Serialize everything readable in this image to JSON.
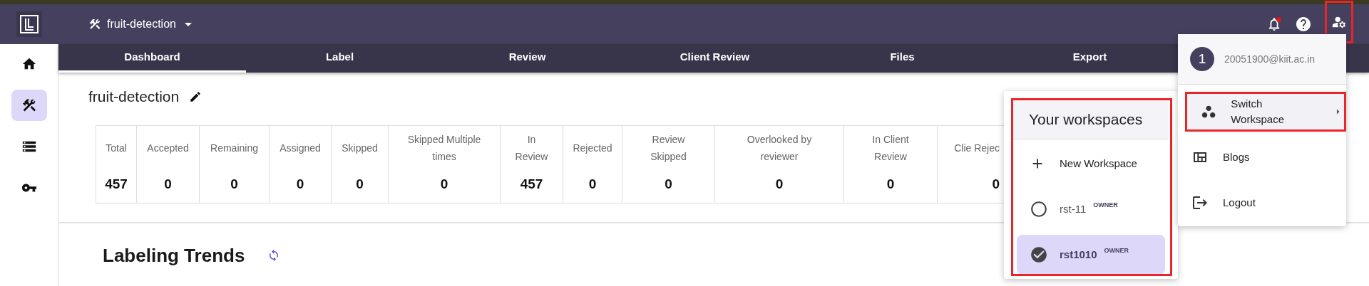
{
  "header": {
    "project": "fruit-detection",
    "notifications_unread": true,
    "account_highlighted": true
  },
  "sidebar": {
    "items": [
      {
        "kind": "home",
        "selected": false
      },
      {
        "kind": "tools",
        "selected": true
      },
      {
        "kind": "list",
        "selected": false
      },
      {
        "kind": "key",
        "selected": false
      }
    ]
  },
  "tabs": [
    {
      "label": "Dashboard",
      "selected": true
    },
    {
      "label": "Label",
      "selected": false
    },
    {
      "label": "Review",
      "selected": false
    },
    {
      "label": "Client Review",
      "selected": false
    },
    {
      "label": "Files",
      "selected": false
    },
    {
      "label": "Export",
      "selected": false
    }
  ],
  "page": {
    "title": "fruit-detection",
    "section_title": "Labeling Trends"
  },
  "stats": [
    {
      "label": "Total",
      "value": "457"
    },
    {
      "label": "Accepted",
      "value": "0"
    },
    {
      "label": "Remaining",
      "value": "0"
    },
    {
      "label": "Assigned",
      "value": "0"
    },
    {
      "label": "Skipped",
      "value": "0"
    },
    {
      "label": "Skipped Multiple times",
      "value": "0"
    },
    {
      "label": "In Review",
      "value": "457"
    },
    {
      "label": "Rejected",
      "value": "0"
    },
    {
      "label": "Review Skipped",
      "value": "0"
    },
    {
      "label": "Overlooked by reviewer",
      "value": "0"
    },
    {
      "label": "In Client Review",
      "value": "0"
    },
    {
      "label": "Clie Rejec",
      "value": "0"
    }
  ],
  "account_menu": {
    "avatar": "1",
    "email": "20051900@kiit.ac.in",
    "items": [
      {
        "kind": "switch",
        "label": "Switch Workspace",
        "highlighted": true
      },
      {
        "kind": "blogs",
        "label": "Blogs",
        "highlighted": false
      },
      {
        "kind": "logout",
        "label": "Logout",
        "highlighted": false
      }
    ]
  },
  "workspaces": {
    "title": "Your workspaces",
    "highlighted": true,
    "items": [
      {
        "kind": "new",
        "label": "New Workspace"
      },
      {
        "kind": "workspace",
        "label": "rst-11",
        "role": "OWNER",
        "selected": false
      },
      {
        "kind": "workspace",
        "label": "rst1010",
        "role": "OWNER",
        "selected": true
      }
    ]
  }
}
